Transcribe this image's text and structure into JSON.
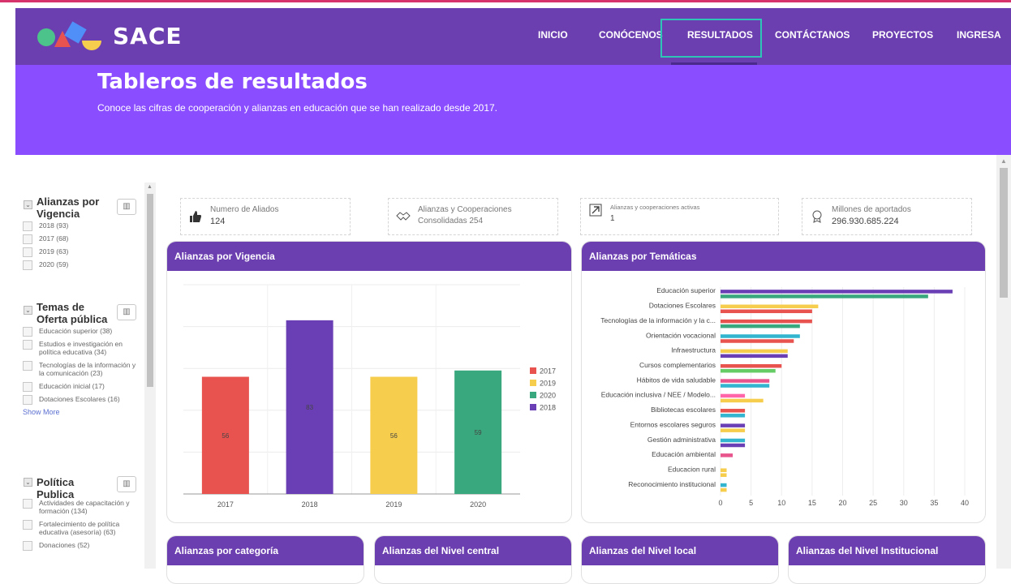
{
  "app": {
    "logo_text": "SACE"
  },
  "nav": {
    "items": [
      {
        "label": "INICIO"
      },
      {
        "label": "CONÓCENOS"
      },
      {
        "label": "RESULTADOS"
      },
      {
        "label": "CONTÁCTANOS"
      },
      {
        "label": "PROYECTOS"
      },
      {
        "label": "INGRESA"
      }
    ],
    "active": "RESULTADOS"
  },
  "hero": {
    "title": "Tableros de resultados",
    "subtitle": "Conoce las cifras de cooperación y alianzas en educación que se han realizado desde 2017."
  },
  "sidebar": {
    "groups": [
      {
        "title": "Alianzas por Vigencia",
        "items": [
          "2018 (93)",
          "2017 (68)",
          "2019 (63)",
          "2020 (59)"
        ]
      },
      {
        "title": "Temas de Oferta pública",
        "items": [
          "Educación superior (38)",
          "Estudios e investigación en política educativa (34)",
          "Tecnologías de la información y la comunicación (23)",
          "Educación inicial (17)",
          "Dotaciones Escolares (16)"
        ],
        "show_more": "Show More"
      },
      {
        "title": "Política Publica",
        "items": [
          "Actividades de capacitación y formación (134)",
          "Fortalecimiento de política educativa (asesoría) (63)",
          "Donaciones (52)"
        ]
      }
    ]
  },
  "kpis": [
    {
      "label": "Numero de Aliados",
      "value": "124",
      "icon": "thumbs-up-icon"
    },
    {
      "label": "Alianzas y Cooperaciones",
      "value": "Consolidadas 254",
      "icon": "handshake-icon"
    },
    {
      "label": "Alianzas y cooperaciones activas",
      "value": "1",
      "icon": "arrow-up-right-icon"
    },
    {
      "label": "Millones de aportados",
      "value": "296.930.685.224",
      "icon": "award-icon"
    }
  ],
  "cards": {
    "vigencia": "Alianzas por Vigencia",
    "tematicas": "Alianzas por Temáticas",
    "categoria": "Alianzas por categoría",
    "nivel_central": "Alianzas del Nivel central",
    "nivel_local": "Alianzas del Nivel local",
    "nivel_institucional": "Alianzas del Nivel Institucional"
  },
  "colors": {
    "nav": "#6c3fb0",
    "hero": "#8a4dff",
    "active_border": "#2ec4b6"
  },
  "chart_data": [
    {
      "type": "bar",
      "categories": [
        "2017",
        "2018",
        "2019",
        "2020"
      ],
      "values": [
        56,
        83,
        56,
        59
      ],
      "colors": [
        "#e8534f",
        "#6a3fb5",
        "#f6cd4c",
        "#3aa87e"
      ],
      "legend": [
        "2017",
        "2019",
        "2020",
        "2018"
      ],
      "legend_colors": [
        "#e8534f",
        "#f6cd4c",
        "#3aa87e",
        "#6a3fb5"
      ],
      "legend_position": "right",
      "ylim": [
        0,
        100
      ],
      "grid": true
    },
    {
      "type": "bar",
      "orientation": "horizontal",
      "categories": [
        "Educación superior",
        "Dotaciones Escolares",
        "Tecnologías de la información y la c...",
        "Orientación vocacional",
        "Infraestructura",
        "Cursos complementarios",
        "Hábitos de vida saludable",
        "Educación inclusiva / NEE / Modelo...",
        "Bibliotecas escolares",
        "Entornos escolares seguros",
        "Gestión administrativa",
        "Educación ambiental",
        "Educacion rural",
        "Reconocimiento institucional"
      ],
      "series": [
        {
          "values": [
            38,
            16,
            15,
            13,
            11,
            10,
            8,
            4,
            4,
            4,
            4,
            2,
            1,
            1
          ]
        },
        {
          "values": [
            34,
            15,
            13,
            12,
            11,
            9,
            8,
            7,
            4,
            4,
            4,
            0,
            1,
            1
          ]
        }
      ],
      "xticks": [
        0,
        5,
        10,
        15,
        20,
        25,
        30,
        35,
        40
      ],
      "xlim": [
        0,
        40
      ],
      "grid": true
    }
  ]
}
